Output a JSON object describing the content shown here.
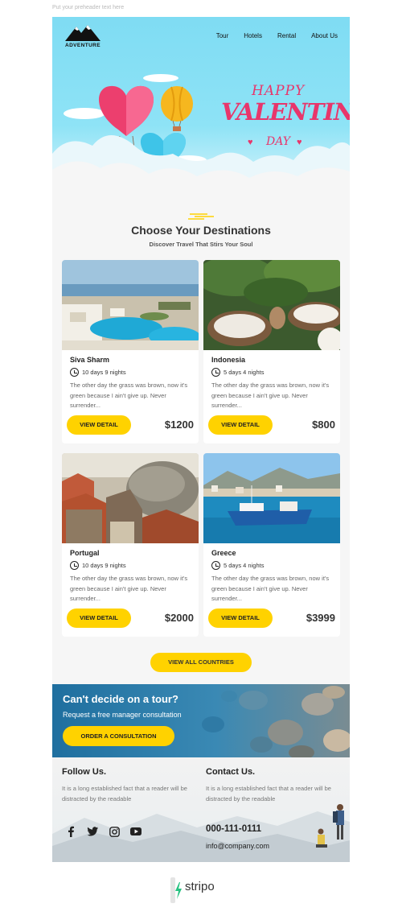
{
  "preheader": "Put your preheader text here",
  "header": {
    "logo_text": "ADVENTURE",
    "nav": [
      "Tour",
      "Hotels",
      "Rental",
      "About Us"
    ]
  },
  "hero": {
    "line1": "HAPPY",
    "line2": "VALENTINE'S",
    "line3": "DAY"
  },
  "destinations": {
    "title": "Choose Your Destinations",
    "subtitle": "Discover Travel That Stirs Your Soul",
    "cards": [
      {
        "name": "Siva Sharm",
        "duration": "10 days 9 nights",
        "description": "The other day the grass was brown, now it's green because I ain't give up. Never surrender...",
        "button": "VIEW DETAIL",
        "price": "$1200"
      },
      {
        "name": "Indonesia",
        "duration": "5 days 4 nights",
        "description": "The other day the grass was brown, now it's green because I ain't give up. Never surrender...",
        "button": "VIEW DETAIL",
        "price": "$800"
      },
      {
        "name": "Portugal",
        "duration": "10 days 9 nights",
        "description": "The other day the grass was brown, now it's green because I ain't give up. Never surrender...",
        "button": "VIEW DETAIL",
        "price": "$2000"
      },
      {
        "name": "Greece",
        "duration": "5 days 4 nights",
        "description": "The other day the grass was brown, now it's green because I ain't give up. Never surrender...",
        "button": "VIEW DETAIL",
        "price": "$3999"
      }
    ],
    "view_all": "VIEW ALL COUNTRIES"
  },
  "cta": {
    "title": "Can't decide on a tour?",
    "subtitle": "Request a free manager consultation",
    "button": "ORDER A CONSULTATION"
  },
  "footer": {
    "follow_title": "Follow Us.",
    "follow_text": "It is a long established fact that a reader will be distracted by the readable",
    "contact_title": "Contact Us.",
    "contact_text": "It is a long established fact that a reader will be distracted by the readable",
    "phone": "000-111-0111",
    "email": "info@company.com",
    "socials": [
      "facebook-icon",
      "twitter-icon",
      "instagram-icon",
      "youtube-icon"
    ]
  },
  "badge": {
    "text": "stripo"
  },
  "colors": {
    "accent": "#ffd200",
    "hero_sky": "#8ee3f6",
    "valentine_pink": "#e8366b",
    "brand_green": "#26c281"
  }
}
